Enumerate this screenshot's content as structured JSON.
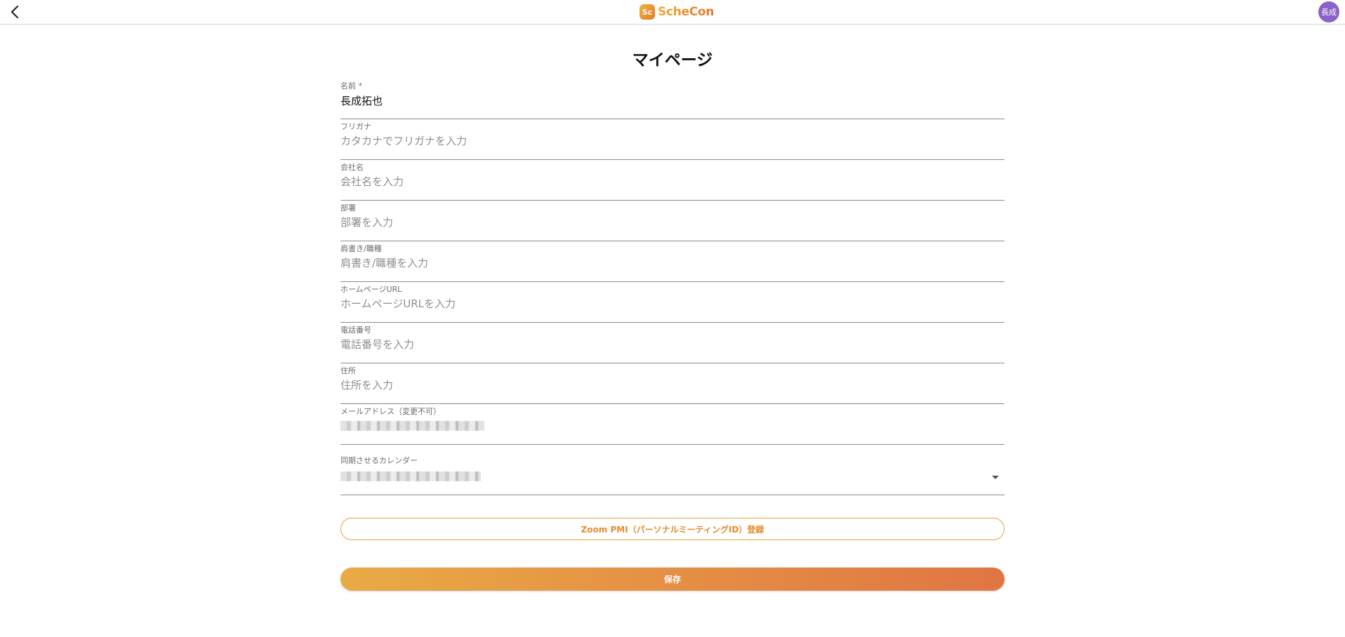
{
  "header": {
    "logo_mark": "Sc",
    "logo_text": "ScheCon",
    "avatar_text": "長成"
  },
  "page_title": "マイページ",
  "fields": [
    {
      "label": "名前 *",
      "value": "長成拓也",
      "placeholder": ""
    },
    {
      "label": "フリガナ",
      "value": "",
      "placeholder": "カタカナでフリガナを入力"
    },
    {
      "label": "会社名",
      "value": "",
      "placeholder": "会社名を入力"
    },
    {
      "label": "部署",
      "value": "",
      "placeholder": "部署を入力"
    },
    {
      "label": "肩書き/職種",
      "value": "",
      "placeholder": "肩書き/職種を入力"
    },
    {
      "label": "ホームページURL",
      "value": "",
      "placeholder": "ホームページURLを入力"
    },
    {
      "label": "電話番号",
      "value": "",
      "placeholder": "電話番号を入力"
    },
    {
      "label": "住所",
      "value": "",
      "placeholder": "住所を入力"
    },
    {
      "label": "メールアドレス（変更不可）"
    }
  ],
  "calendar_select": {
    "label": "同期させるカレンダー"
  },
  "buttons": {
    "zoom": "Zoom PMI（パーソナルミーティングID）登録",
    "save": "保存"
  },
  "colors": {
    "accent": "#e8a13e",
    "save_gradient_start": "#e9aa45",
    "save_gradient_end": "#e07544",
    "avatar": "#8a62c8"
  }
}
